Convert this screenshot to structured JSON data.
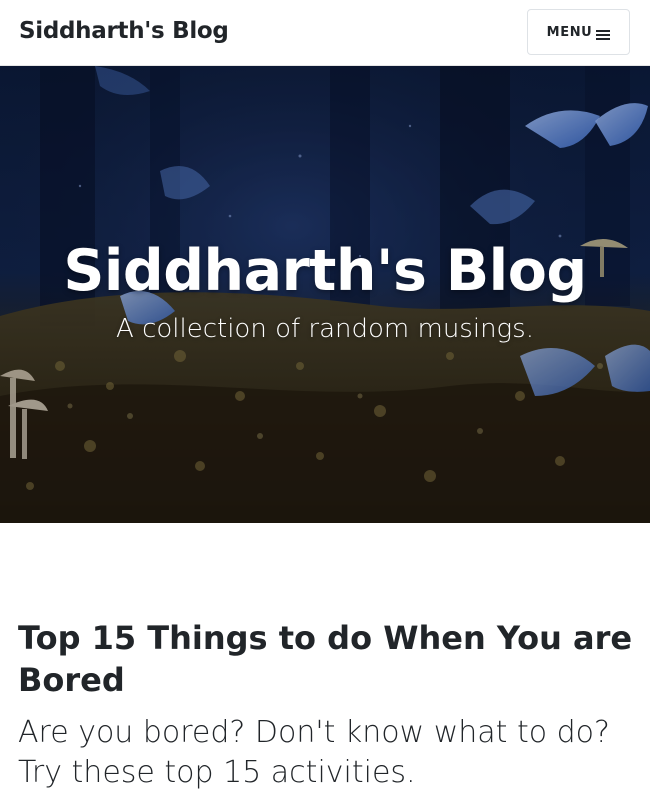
{
  "navbar": {
    "brand": "Siddharth's Blog",
    "menu_label": "MENU",
    "menu_icon": "bars-icon"
  },
  "hero": {
    "title": "Siddharth's Blog",
    "subtitle": "A collection of random musings.",
    "background_image": "dark-forest-with-blue-butterflies-and-mushrooms"
  },
  "post": {
    "title": "Top 15 Things to do When You are Bored",
    "subtitle": "Are you bored? Don't know what to do? Try these top 15 activities."
  },
  "colors": {
    "text": "#212529",
    "navbar_bg": "#ffffff",
    "hero_overlay": "#0a1226",
    "butterfly": "#6f9be8"
  }
}
